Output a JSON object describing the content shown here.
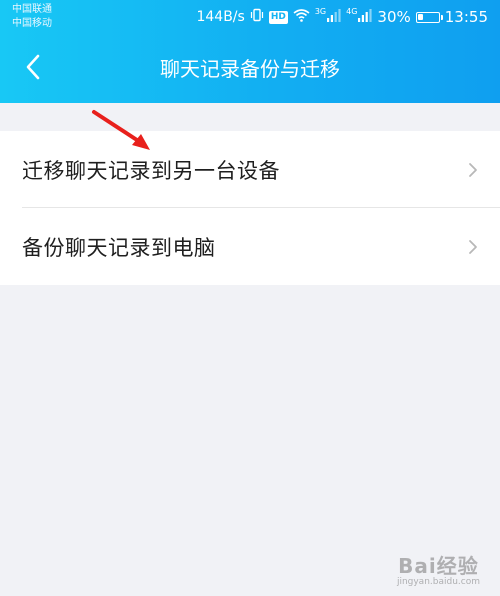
{
  "status_bar": {
    "carrier1": "中国联通",
    "carrier2": "中国移动",
    "speed": "144B/s",
    "hd": "HD",
    "net1": "3G",
    "net2": "4G",
    "battery_level": 0.3,
    "battery_text": "30%",
    "time": "13:55"
  },
  "header": {
    "title": "聊天记录备份与迁移"
  },
  "list": {
    "items": [
      {
        "label": "迁移聊天记录到另一台设备"
      },
      {
        "label": "备份聊天记录到电脑"
      }
    ]
  },
  "watermark": {
    "main": "Bai经验",
    "sub": "jingyan.baidu.com"
  },
  "colors": {
    "header": "#12aef2",
    "background": "#f1f2f6",
    "arrow": "#e8201c"
  }
}
